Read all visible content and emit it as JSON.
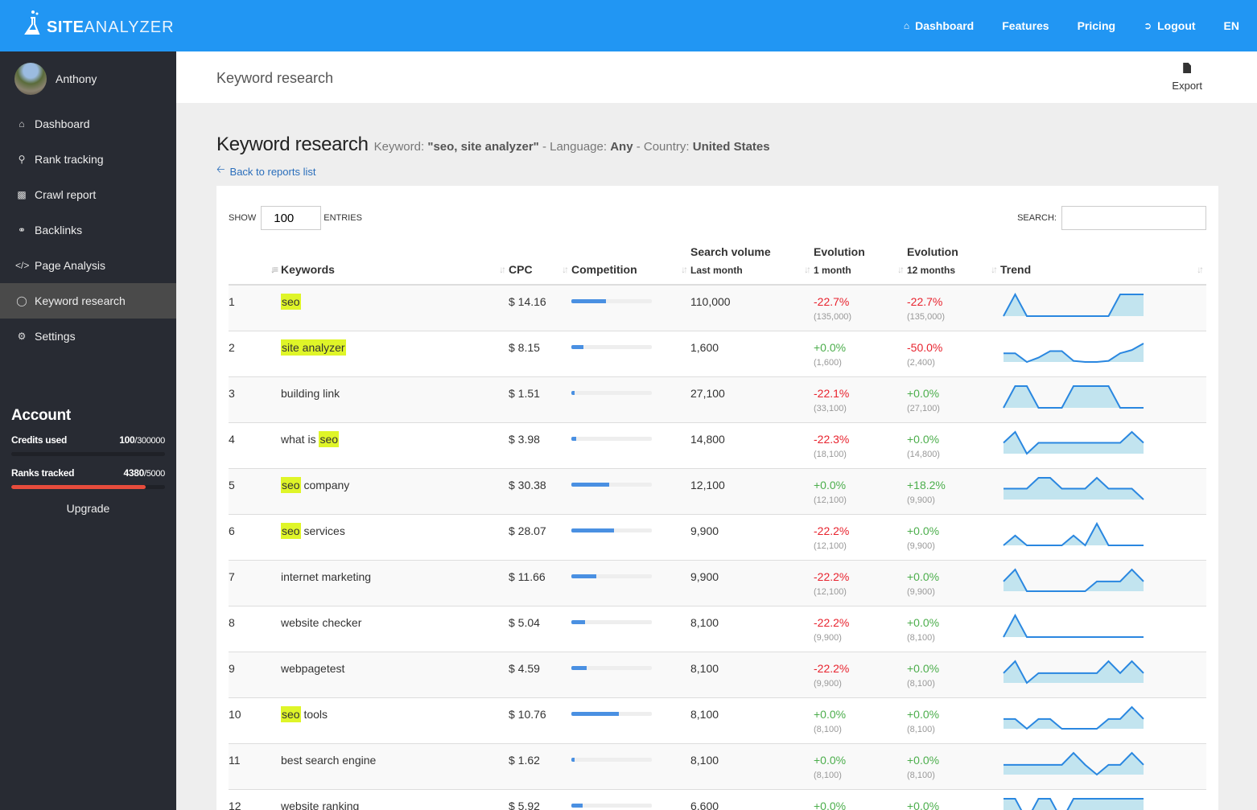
{
  "brand": {
    "name_bold": "SITE",
    "name_light": "ANALYZER"
  },
  "topnav": [
    {
      "label": "Dashboard",
      "icon": "home-icon"
    },
    {
      "label": "Features"
    },
    {
      "label": "Pricing"
    },
    {
      "label": "Logout",
      "icon": "sign-out-icon"
    },
    {
      "label": "EN"
    }
  ],
  "user": {
    "name": "Anthony"
  },
  "sidebar": {
    "items": [
      {
        "label": "Dashboard",
        "icon": "home-icon"
      },
      {
        "label": "Rank tracking",
        "icon": "search-icon"
      },
      {
        "label": "Crawl report",
        "icon": "sitemap-icon"
      },
      {
        "label": "Backlinks",
        "icon": "link-icon"
      },
      {
        "label": "Page Analysis",
        "icon": "code-icon"
      },
      {
        "label": "Keyword research",
        "icon": "lightbulb-icon",
        "active": true
      },
      {
        "label": "Settings",
        "icon": "gears-icon"
      }
    ]
  },
  "account": {
    "title": "Account",
    "credits": {
      "label": "Credits used",
      "used": "100",
      "total": "/300000",
      "fraction": 0.0003
    },
    "ranks": {
      "label": "Ranks tracked",
      "used": "4380",
      "total": "/5000",
      "fraction": 0.876
    },
    "upgrade_label": "Upgrade"
  },
  "page_header": {
    "title": "Keyword research",
    "export_label": "Export"
  },
  "report": {
    "title": "Keyword research",
    "keyword_label": "Keyword: ",
    "keyword_value": "\"seo, site analyzer\"",
    "language_label": " - Language: ",
    "language_value": "Any",
    "country_label": " - Country: ",
    "country_value": "United States",
    "back_label": "Back to reports list"
  },
  "controls": {
    "show_label": "SHOW",
    "show_value": "100",
    "entries_label": "ENTRIES",
    "search_label": "SEARCH:",
    "search_value": ""
  },
  "table": {
    "headers": {
      "keywords": "Keywords",
      "cpc": "CPC",
      "competition": "Competition",
      "volume": "Search volume",
      "volume_sub": "Last month",
      "evo1": "Evolution",
      "evo1_sub": "1 month",
      "evo12": "Evolution",
      "evo12_sub": "12 months",
      "trend": "Trend"
    },
    "rows": [
      {
        "n": "1",
        "kw": [
          [
            "seo",
            true
          ]
        ],
        "cpc": "$ 14.16",
        "comp": 0.43,
        "vol": "110,000",
        "e1": "-22.7%",
        "e1p": "(135,000)",
        "e1s": "neg",
        "e12": "-22.7%",
        "e12p": "(135,000)",
        "e12s": "neg",
        "trend": [
          0,
          1,
          0,
          0,
          0,
          0,
          0,
          0,
          0,
          0,
          1,
          1,
          1
        ]
      },
      {
        "n": "2",
        "kw": [
          [
            "site analyzer",
            true
          ]
        ],
        "cpc": "$ 8.15",
        "comp": 0.15,
        "vol": "1,600",
        "e1": "+0.0%",
        "e1p": "(1,600)",
        "e1s": "pos",
        "e12": "-50.0%",
        "e12p": "(2,400)",
        "e12s": "neg",
        "trend": [
          0.4,
          0.4,
          0,
          0.2,
          0.5,
          0.5,
          0.05,
          0,
          0,
          0.05,
          0.4,
          0.55,
          0.85
        ]
      },
      {
        "n": "3",
        "kw": [
          [
            "building link",
            false
          ]
        ],
        "cpc": "$ 1.51",
        "comp": 0.04,
        "vol": "27,100",
        "e1": "-22.1%",
        "e1p": "(33,100)",
        "e1s": "neg",
        "e12": "+0.0%",
        "e12p": "(27,100)",
        "e12s": "pos",
        "trend": [
          0,
          1,
          1,
          0,
          0,
          0,
          1,
          1,
          1,
          1,
          0,
          0,
          0
        ]
      },
      {
        "n": "4",
        "kw": [
          [
            "what is ",
            false
          ],
          [
            "seo",
            true
          ]
        ],
        "cpc": "$ 3.98",
        "comp": 0.06,
        "vol": "14,800",
        "e1": "-22.3%",
        "e1p": "(18,100)",
        "e1s": "neg",
        "e12": "+0.0%",
        "e12p": "(14,800)",
        "e12s": "pos",
        "trend": [
          0.5,
          1,
          0,
          0.5,
          0.5,
          0.5,
          0.5,
          0.5,
          0.5,
          0.5,
          0.5,
          1,
          0.5
        ]
      },
      {
        "n": "5",
        "kw": [
          [
            "seo",
            true
          ],
          [
            " company",
            false
          ]
        ],
        "cpc": "$ 30.38",
        "comp": 0.47,
        "vol": "12,100",
        "e1": "+0.0%",
        "e1p": "(12,100)",
        "e1s": "pos",
        "e12": "+18.2%",
        "e12p": "(9,900)",
        "e12s": "pos",
        "trend": [
          0.5,
          0.5,
          0.5,
          1,
          1,
          0.5,
          0.5,
          0.5,
          1,
          0.5,
          0.5,
          0.5,
          0
        ]
      },
      {
        "n": "6",
        "kw": [
          [
            "seo",
            true
          ],
          [
            " services",
            false
          ]
        ],
        "cpc": "$ 28.07",
        "comp": 0.53,
        "vol": "9,900",
        "e1": "-22.2%",
        "e1p": "(12,100)",
        "e1s": "neg",
        "e12": "+0.0%",
        "e12p": "(9,900)",
        "e12s": "pos",
        "trend": [
          0,
          0.45,
          0,
          0,
          0,
          0,
          0.45,
          0,
          1,
          0,
          0,
          0,
          0
        ]
      },
      {
        "n": "7",
        "kw": [
          [
            "internet marketing",
            false
          ]
        ],
        "cpc": "$ 11.66",
        "comp": 0.31,
        "vol": "9,900",
        "e1": "-22.2%",
        "e1p": "(12,100)",
        "e1s": "neg",
        "e12": "+0.0%",
        "e12p": "(9,900)",
        "e12s": "pos",
        "trend": [
          0.45,
          1,
          0,
          0,
          0,
          0,
          0,
          0,
          0.45,
          0.45,
          0.45,
          1,
          0.45
        ]
      },
      {
        "n": "8",
        "kw": [
          [
            "website checker",
            false
          ]
        ],
        "cpc": "$ 5.04",
        "comp": 0.17,
        "vol": "8,100",
        "e1": "-22.2%",
        "e1p": "(9,900)",
        "e1s": "neg",
        "e12": "+0.0%",
        "e12p": "(8,100)",
        "e12s": "pos",
        "trend": [
          0,
          1,
          0,
          0,
          0,
          0,
          0,
          0,
          0,
          0,
          0,
          0,
          0
        ]
      },
      {
        "n": "9",
        "kw": [
          [
            "webpagetest",
            false
          ]
        ],
        "cpc": "$ 4.59",
        "comp": 0.19,
        "vol": "8,100",
        "e1": "-22.2%",
        "e1p": "(9,900)",
        "e1s": "neg",
        "e12": "+0.0%",
        "e12p": "(8,100)",
        "e12s": "pos",
        "trend": [
          0.45,
          1,
          0,
          0.45,
          0.45,
          0.45,
          0.45,
          0.45,
          0.45,
          1,
          0.45,
          1,
          0.45
        ]
      },
      {
        "n": "10",
        "kw": [
          [
            "seo",
            true
          ],
          [
            " tools",
            false
          ]
        ],
        "cpc": "$ 10.76",
        "comp": 0.59,
        "vol": "8,100",
        "e1": "+0.0%",
        "e1p": "(8,100)",
        "e1s": "pos",
        "e12": "+0.0%",
        "e12p": "(8,100)",
        "e12s": "pos",
        "trend": [
          0.45,
          0.45,
          0,
          0.45,
          0.45,
          0,
          0,
          0,
          0,
          0.45,
          0.45,
          1,
          0.45
        ]
      },
      {
        "n": "11",
        "kw": [
          [
            "best search engine",
            false
          ]
        ],
        "cpc": "$ 1.62",
        "comp": 0.04,
        "vol": "8,100",
        "e1": "+0.0%",
        "e1p": "(8,100)",
        "e1s": "pos",
        "e12": "+0.0%",
        "e12p": "(8,100)",
        "e12s": "pos",
        "trend": [
          0.45,
          0.45,
          0.45,
          0.45,
          0.45,
          0.45,
          1,
          0.45,
          0,
          0.45,
          0.45,
          1,
          0.45
        ]
      },
      {
        "n": "12",
        "kw": [
          [
            "website ranking",
            false
          ]
        ],
        "cpc": "$ 5.92",
        "comp": 0.14,
        "vol": "6,600",
        "e1": "+0.0%",
        "e1p": "",
        "e1s": "pos",
        "e12": "+0.0%",
        "e12p": "",
        "e12s": "pos",
        "trend": [
          1,
          1,
          0,
          1,
          1,
          0,
          1,
          1,
          1,
          1,
          1,
          1,
          1
        ]
      }
    ]
  },
  "colors": {
    "brand": "#2196f3",
    "sidebar": "#282b33",
    "negative": "#e8232e",
    "positive": "#4cae4c",
    "highlight": "#dff528",
    "trend_line": "#2a87e0",
    "trend_fill": "#c2e4ef",
    "ranks_bar": "#e74c3c"
  }
}
